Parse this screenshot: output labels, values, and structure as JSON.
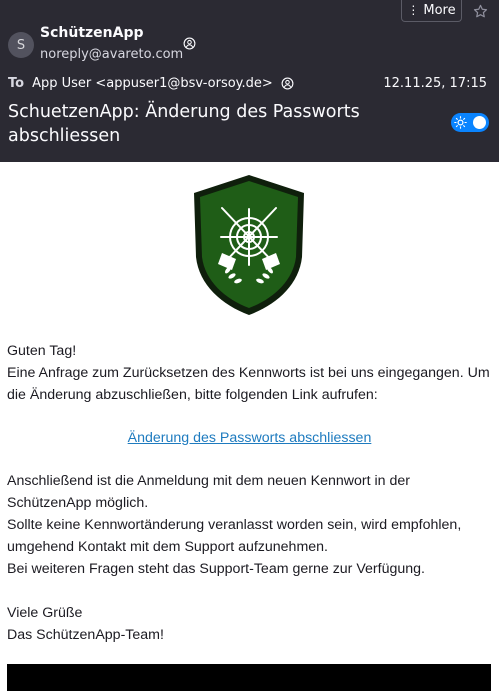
{
  "header": {
    "more_label": "More",
    "more_icon": "vertical-ellipsis",
    "star_icon": "star-outline",
    "sender": {
      "initial": "S",
      "name": "SchützenApp",
      "email": "noreply@avareto.com"
    },
    "to_label": "To",
    "recipient": "App User <appuser1@bsv-orsoy.de>",
    "date": "12.11.25, 17:15",
    "subject": "SchuetzenApp: Änderung des Passworts abschliessen",
    "theme_toggle": {
      "state": "on",
      "icon": "sun-icon"
    }
  },
  "colors": {
    "header_bg": "#2b2a33",
    "link": "#1e7bbf",
    "toggle": "#0a84ff",
    "shield_green": "#1f5d17",
    "shield_border": "#0f1f0c"
  },
  "email": {
    "logo": "green shield with crosshair target, crossed rifles and laurel",
    "greeting": "Guten Tag!",
    "paragraph1": "Eine Anfrage zum Zurücksetzen des Kennworts ist bei uns eingegangen. Um die Änderung abzuschließen, bitte folgenden Link aufrufen:",
    "link_text": "Änderung des Passworts abschliessen",
    "paragraph2_lines": [
      "Anschließend ist die Anmeldung mit dem neuen Kennwort in der SchützenApp möglich.",
      "Sollte keine Kennwortänderung veranlasst worden sein, wird empfohlen, umgehend Kontakt mit dem Support aufzunehmen.",
      "Bei weiteren Fragen steht das Support-Team gerne zur Verfügung."
    ],
    "closing_lines": [
      "Viele Grüße",
      "Das SchützenApp-Team!"
    ]
  }
}
